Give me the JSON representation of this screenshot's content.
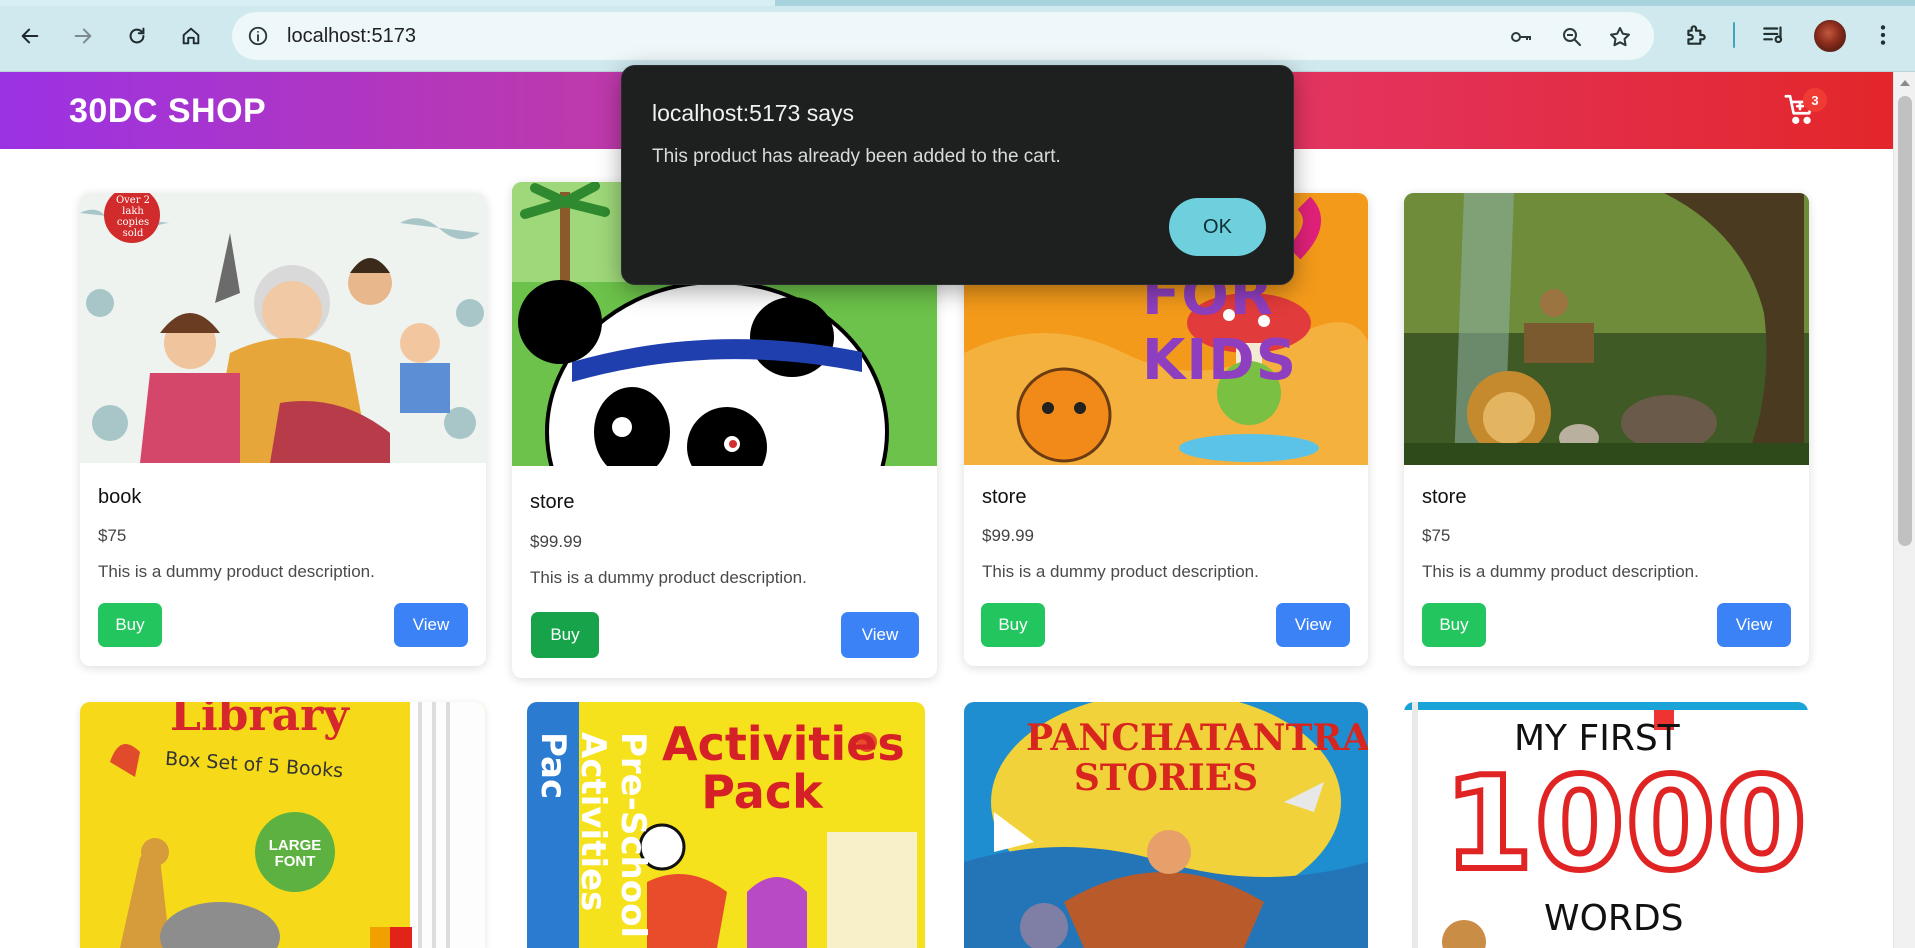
{
  "browser": {
    "url": "localhost:5173",
    "colors": {
      "chrome_bg": "#cfe9ee",
      "omnibox_bg": "#eef7f9"
    },
    "icons": [
      "back-arrow-icon",
      "forward-arrow-icon",
      "reload-icon",
      "home-icon",
      "site-info-icon",
      "password-key-icon",
      "zoom-icon",
      "bookmark-star-icon",
      "extensions-icon",
      "media-control-icon",
      "profile-avatar",
      "more-menu-icon"
    ]
  },
  "header": {
    "brand": "30DC SHOP",
    "cart_count": "3",
    "gradient": [
      "#9b32e3",
      "#e3262a"
    ]
  },
  "products": [
    {
      "name": "book",
      "price": "$75",
      "description": "This is a dummy product description.",
      "buy_label": "Buy",
      "view_label": "View"
    },
    {
      "name": "store",
      "price": "$99.99",
      "description": "This is a dummy product description.",
      "buy_label": "Buy",
      "view_label": "View"
    },
    {
      "name": "store",
      "price": "$99.99",
      "description": "This is a dummy product description.",
      "buy_label": "Buy",
      "view_label": "View"
    },
    {
      "name": "store",
      "price": "$75",
      "description": "This is a dummy product description.",
      "buy_label": "Buy",
      "view_label": "View"
    }
  ],
  "book_covers_row2": [
    {
      "title_text": "Library",
      "subtitle": "Box Set of 5 Books",
      "badge": "LARGE FONT"
    },
    {
      "title_text": "Activities Pack",
      "side_text": "Pre-School Activities Pac"
    },
    {
      "title_text": "PANCHATANTRA STORIES"
    },
    {
      "title_text": "MY FIRST",
      "big_text": "1000",
      "bottom_text": "WORDS"
    }
  ],
  "cover_texts_row1": {
    "card1_badge": "Over 2 lakh copies sold",
    "card3_title": "FOR KIDS"
  },
  "alert": {
    "title": "localhost:5173 says",
    "message": "This product has already been added to the cart.",
    "ok_label": "OK"
  },
  "colors": {
    "buy": "#22c55e",
    "view": "#3b82f6",
    "alert_bg": "#1e2020",
    "alert_ok": "#6fd0dd"
  }
}
